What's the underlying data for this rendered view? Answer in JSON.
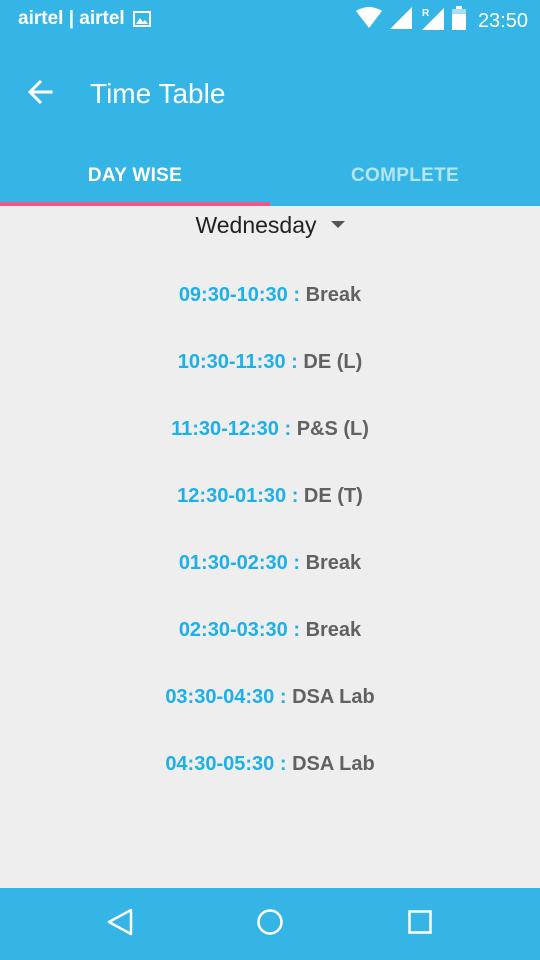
{
  "status_bar": {
    "carrier": "airtel | airtel",
    "time": "23:50",
    "icons": [
      "image-icon",
      "wifi-icon",
      "signal-icon",
      "roaming-signal-icon",
      "battery-icon"
    ]
  },
  "app_bar": {
    "title": "Time Table",
    "back_icon": "arrow-left-icon"
  },
  "tabs": [
    {
      "label": "DAY WISE",
      "selected": true
    },
    {
      "label": "COMPLETE",
      "selected": false
    }
  ],
  "day_selector": {
    "selected": "Wednesday"
  },
  "schedule": [
    {
      "time": "09:30-10:30",
      "separator": " : ",
      "subject": "Break"
    },
    {
      "time": "10:30-11:30",
      "separator": " : ",
      "subject": "DE (L)"
    },
    {
      "time": "11:30-12:30",
      "separator": " : ",
      "subject": "P&S (L)"
    },
    {
      "time": "12:30-01:30",
      "separator": " : ",
      "subject": "DE (T)"
    },
    {
      "time": "01:30-02:30",
      "separator": " : ",
      "subject": "Break"
    },
    {
      "time": "02:30-03:30",
      "separator": " : ",
      "subject": "Break"
    },
    {
      "time": "03:30-04:30",
      "separator": " : ",
      "subject": "DSA Lab"
    },
    {
      "time": "04:30-05:30",
      "separator": " : ",
      "subject": "DSA Lab"
    }
  ],
  "nav_bar": {
    "icons": [
      "nav-back-icon",
      "nav-home-icon",
      "nav-recents-icon"
    ]
  },
  "colors": {
    "primary": "#35B5E5",
    "tab_indicator": "#F0588A",
    "time_text": "#1CB0E8",
    "subject_text": "#616161",
    "background": "#EEEEEE"
  }
}
